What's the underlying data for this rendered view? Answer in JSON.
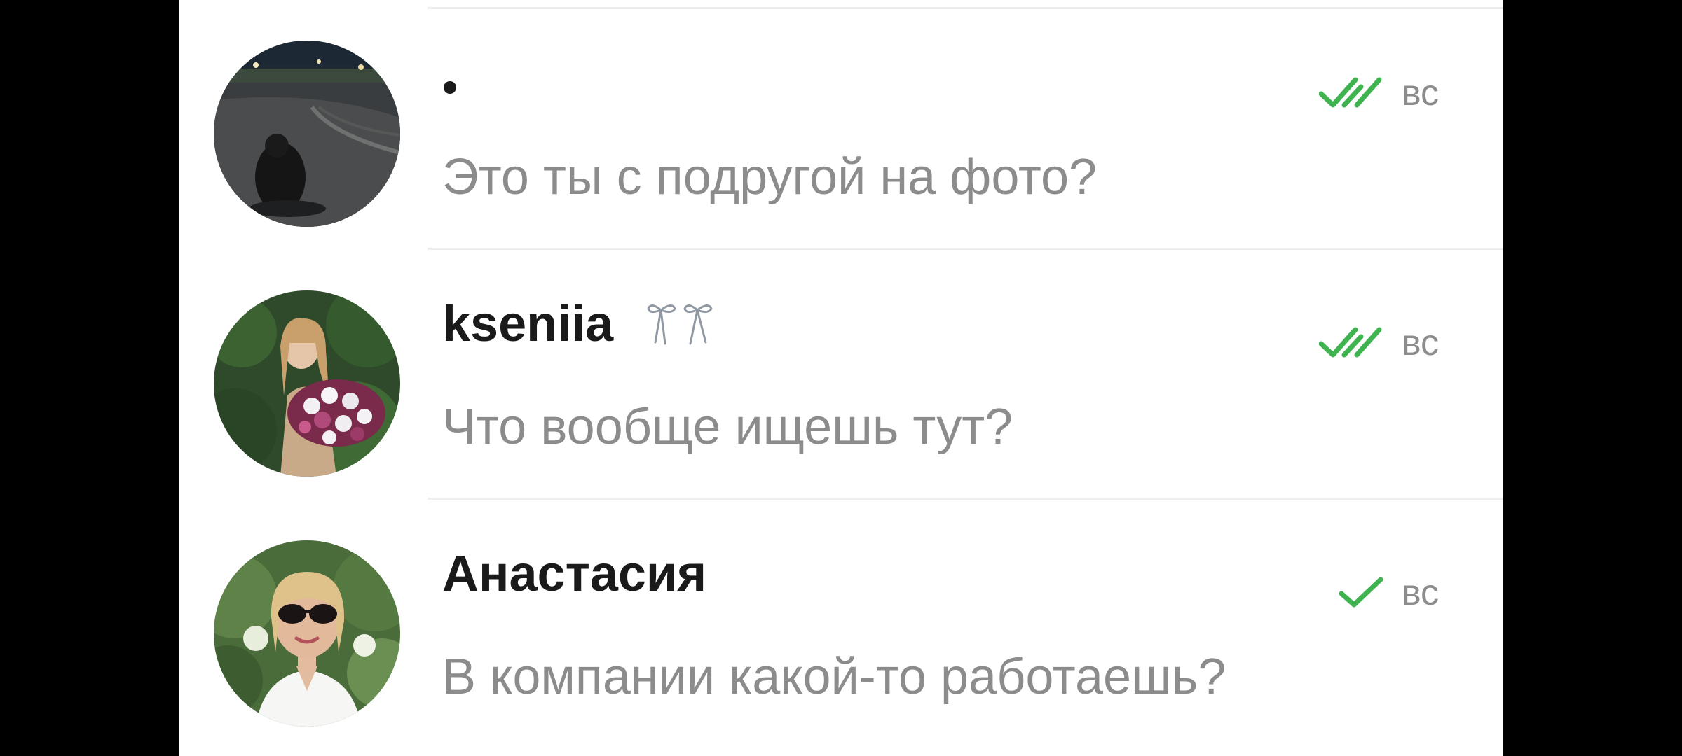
{
  "colors": {
    "background": "#ffffff",
    "name_text": "#1a1a1a",
    "secondary_text": "#8c8c8c",
    "read_check": "#3fb34f",
    "divider": "#eeeeee"
  },
  "chats": [
    {
      "name": "•",
      "preview": "Это ты с подругой на фото?",
      "time": "вс",
      "status_icon": "double-check-icon"
    },
    {
      "name": "kseniia",
      "name_emoji": "bow-ribbon-icon",
      "preview": "Что вообще ищешь тут?",
      "time": "вс",
      "status_icon": "double-check-icon"
    },
    {
      "name": "Анастасия",
      "preview": "В компании какой-то работаешь?",
      "time": "вс",
      "status_icon": "check-icon"
    }
  ]
}
